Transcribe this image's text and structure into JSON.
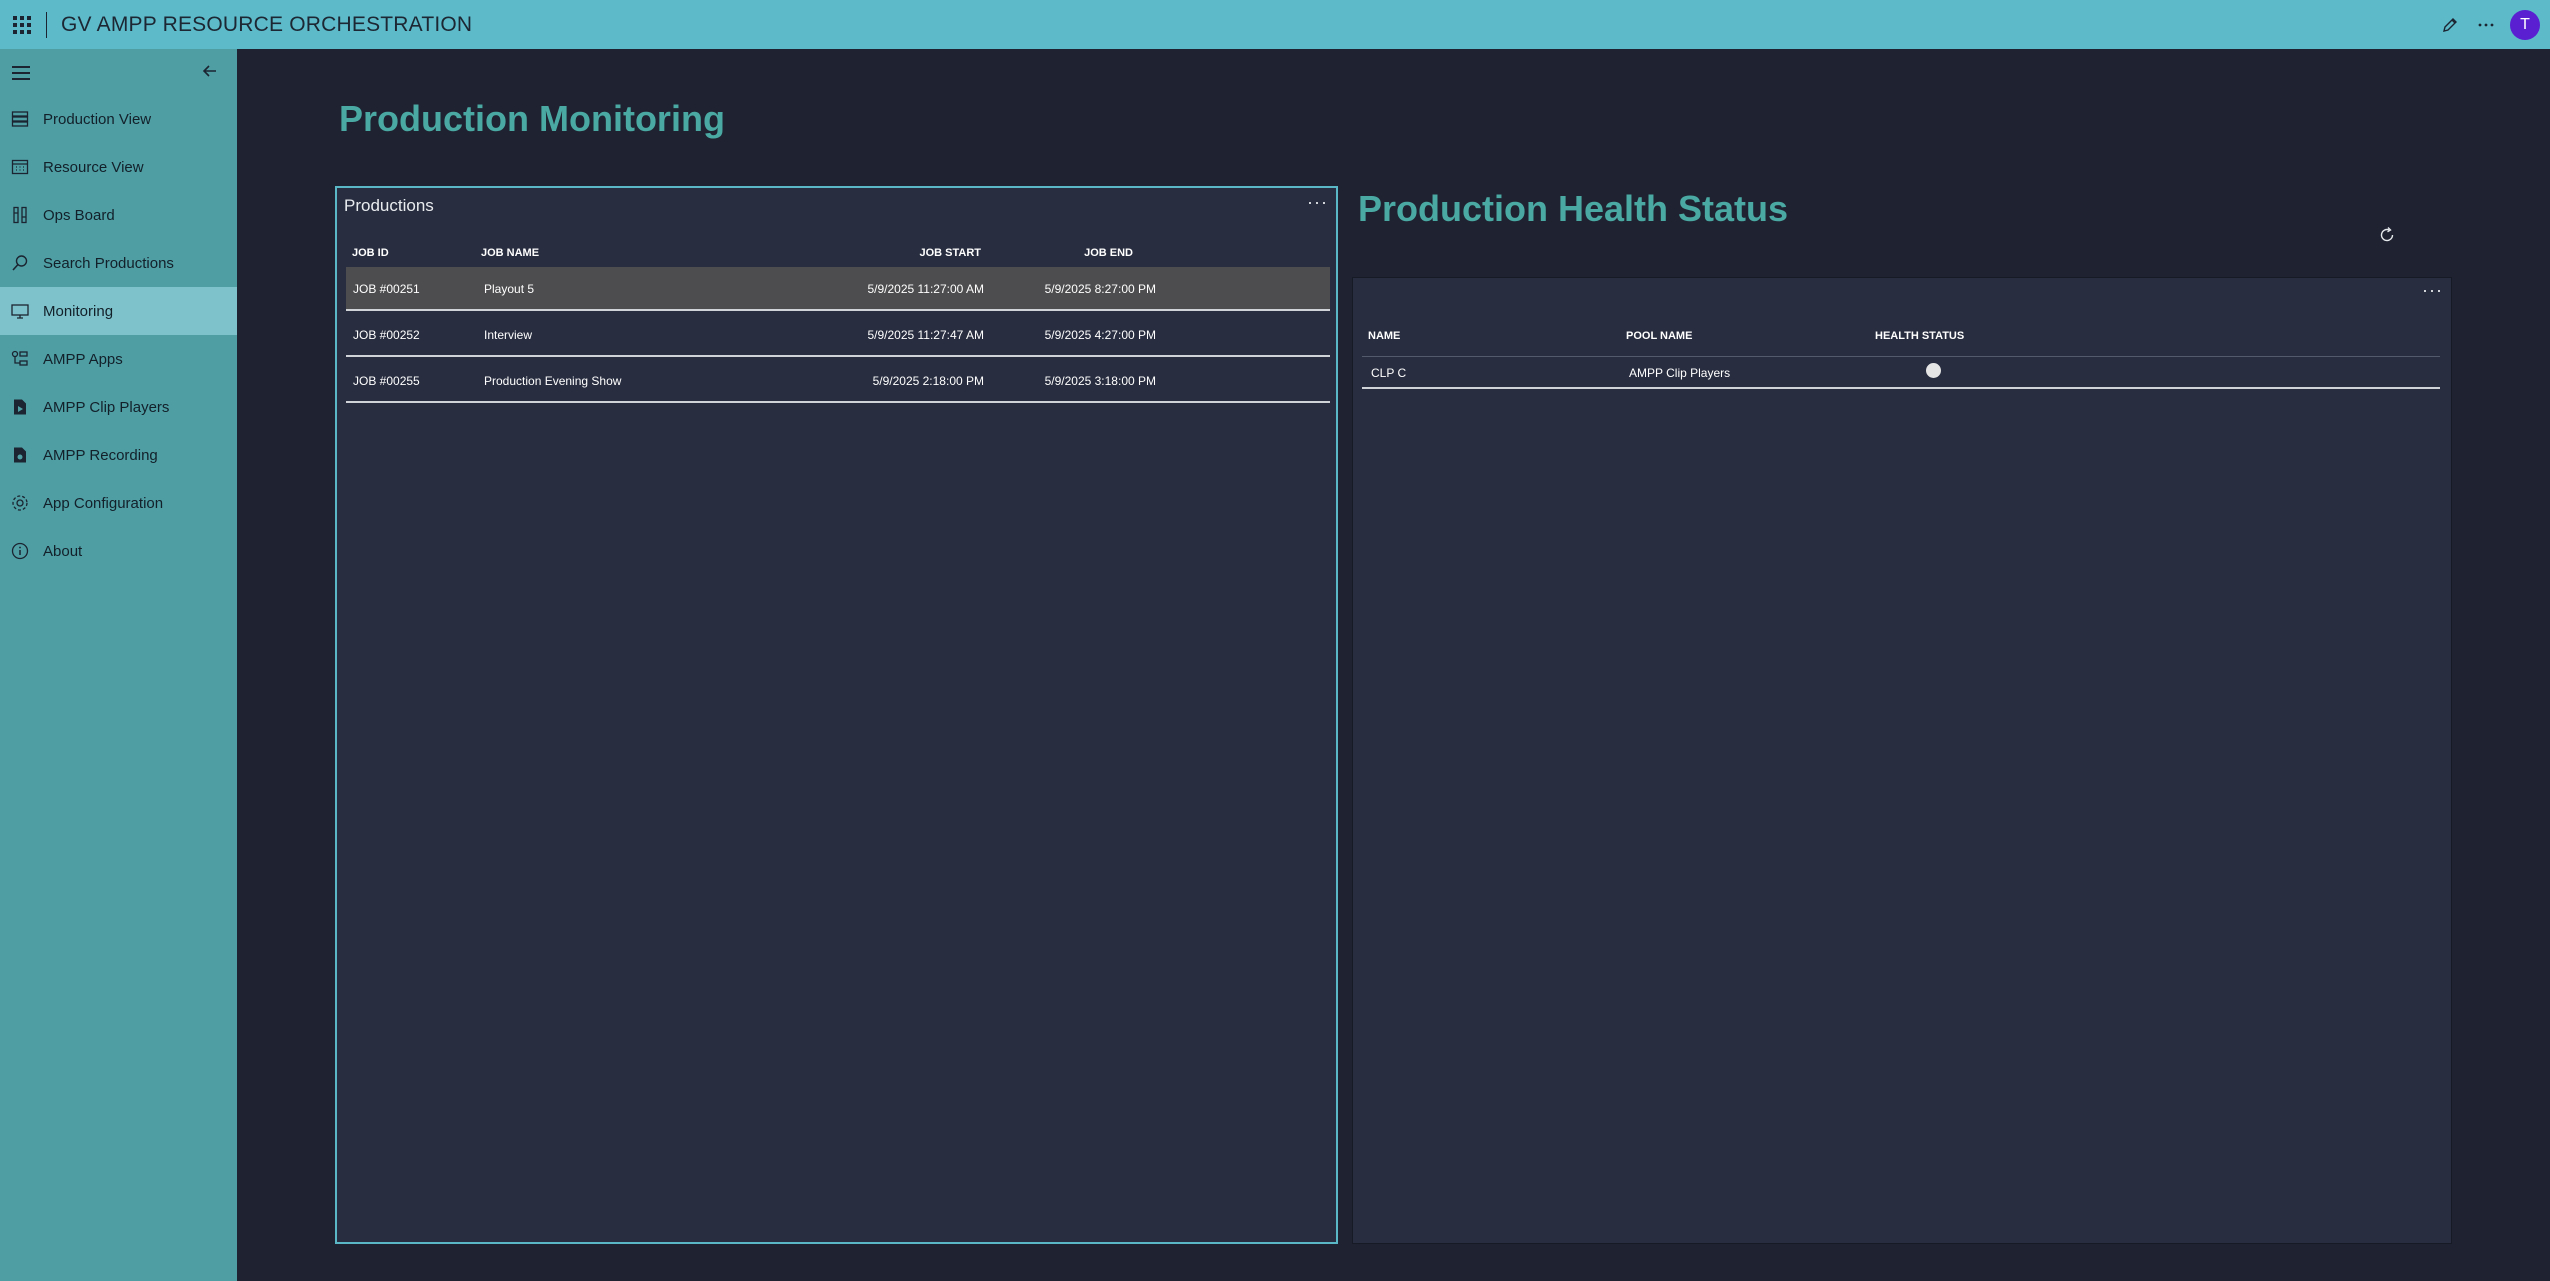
{
  "app": {
    "title": "GV AMPP RESOURCE ORCHESTRATION",
    "avatar_initial": "T"
  },
  "sidebar": {
    "items": [
      {
        "label": "Production View",
        "icon": "production-view-icon"
      },
      {
        "label": "Resource View",
        "icon": "calendar-icon"
      },
      {
        "label": "Ops Board",
        "icon": "ops-board-icon"
      },
      {
        "label": "Search Productions",
        "icon": "search-icon"
      },
      {
        "label": "Monitoring",
        "icon": "monitor-icon",
        "active": true
      },
      {
        "label": "AMPP Apps",
        "icon": "apps-icon"
      },
      {
        "label": "AMPP Clip Players",
        "icon": "clip-player-icon"
      },
      {
        "label": "AMPP Recording",
        "icon": "recording-icon"
      },
      {
        "label": "App Configuration",
        "icon": "gear-icon"
      },
      {
        "label": "About",
        "icon": "info-icon"
      }
    ]
  },
  "main": {
    "page_title": "Production Monitoring",
    "productions": {
      "title": "Productions",
      "menu": "···",
      "columns": [
        "JOB ID",
        "JOB NAME",
        "JOB START",
        "JOB END"
      ],
      "rows": [
        {
          "job_id": "JOB #00251",
          "job_name": "Playout 5",
          "start": "5/9/2025 11:27:00 AM",
          "end": "5/9/2025 8:27:00 PM",
          "selected": true
        },
        {
          "job_id": "JOB #00252",
          "job_name": "Interview",
          "start": "5/9/2025 11:27:47 AM",
          "end": "5/9/2025 4:27:00 PM"
        },
        {
          "job_id": "JOB #00255",
          "job_name": "Production Evening Show",
          "start": "5/9/2025 2:18:00 PM",
          "end": "5/9/2025 3:18:00 PM"
        }
      ]
    },
    "health": {
      "title": "Production Health Status",
      "menu": "···",
      "columns": [
        "NAME",
        "POOL NAME",
        "HEALTH STATUS"
      ],
      "rows": [
        {
          "name": "CLP C",
          "pool_name": "AMPP Clip Players",
          "status_color": "#e5e5e5"
        }
      ]
    }
  },
  "colors": {
    "topbar": "#5cbac9",
    "sidebar": "#4e9ea4",
    "accent_title": "#4aa9a3",
    "background": "#1f2331",
    "panel": "#282d3f",
    "avatar": "#5a1fd1"
  }
}
